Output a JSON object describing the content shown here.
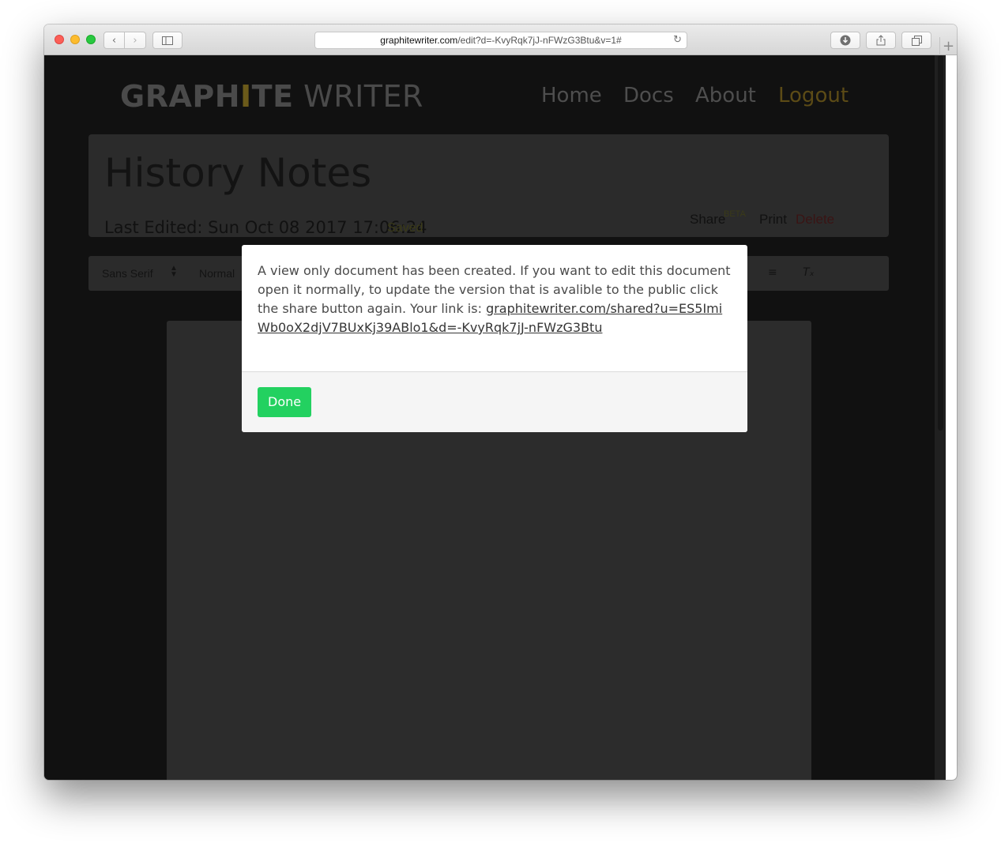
{
  "browser": {
    "url_domain": "graphitewriter.com",
    "url_path": "/edit?d=-KvyRqk7jJ-nFWzG3Btu&v=1#"
  },
  "app": {
    "logo_bold_1": "GRAPH",
    "logo_i": "I",
    "logo_bold_2": "TE",
    "logo_light": " WRITER",
    "nav": {
      "home": "Home",
      "docs": "Docs",
      "about": "About",
      "logout": "Logout"
    }
  },
  "document": {
    "title": "History Notes",
    "last_edited": "Last Edited: Sun Oct 08 2017 17:06:24",
    "saved_status": "Saved",
    "share_label": "Share",
    "beta_label": "BETA",
    "print_label": "Print",
    "delete_label": "Delete"
  },
  "toolbar": {
    "font_select": "Sans Serif",
    "size_select": "Normal"
  },
  "modal": {
    "message": "A view only document has been created. If you want to edit this document open it normally, to update the version that is avalible to the public click the share button again. Your link is:",
    "link": "graphitewriter.com/shared?u=ES5ImiWb0oX2djV7BUxKj39ABlo1&d=-KvyRqk7jJ-nFWzG3Btu",
    "done_label": "Done",
    "done_color": "#23d160"
  }
}
